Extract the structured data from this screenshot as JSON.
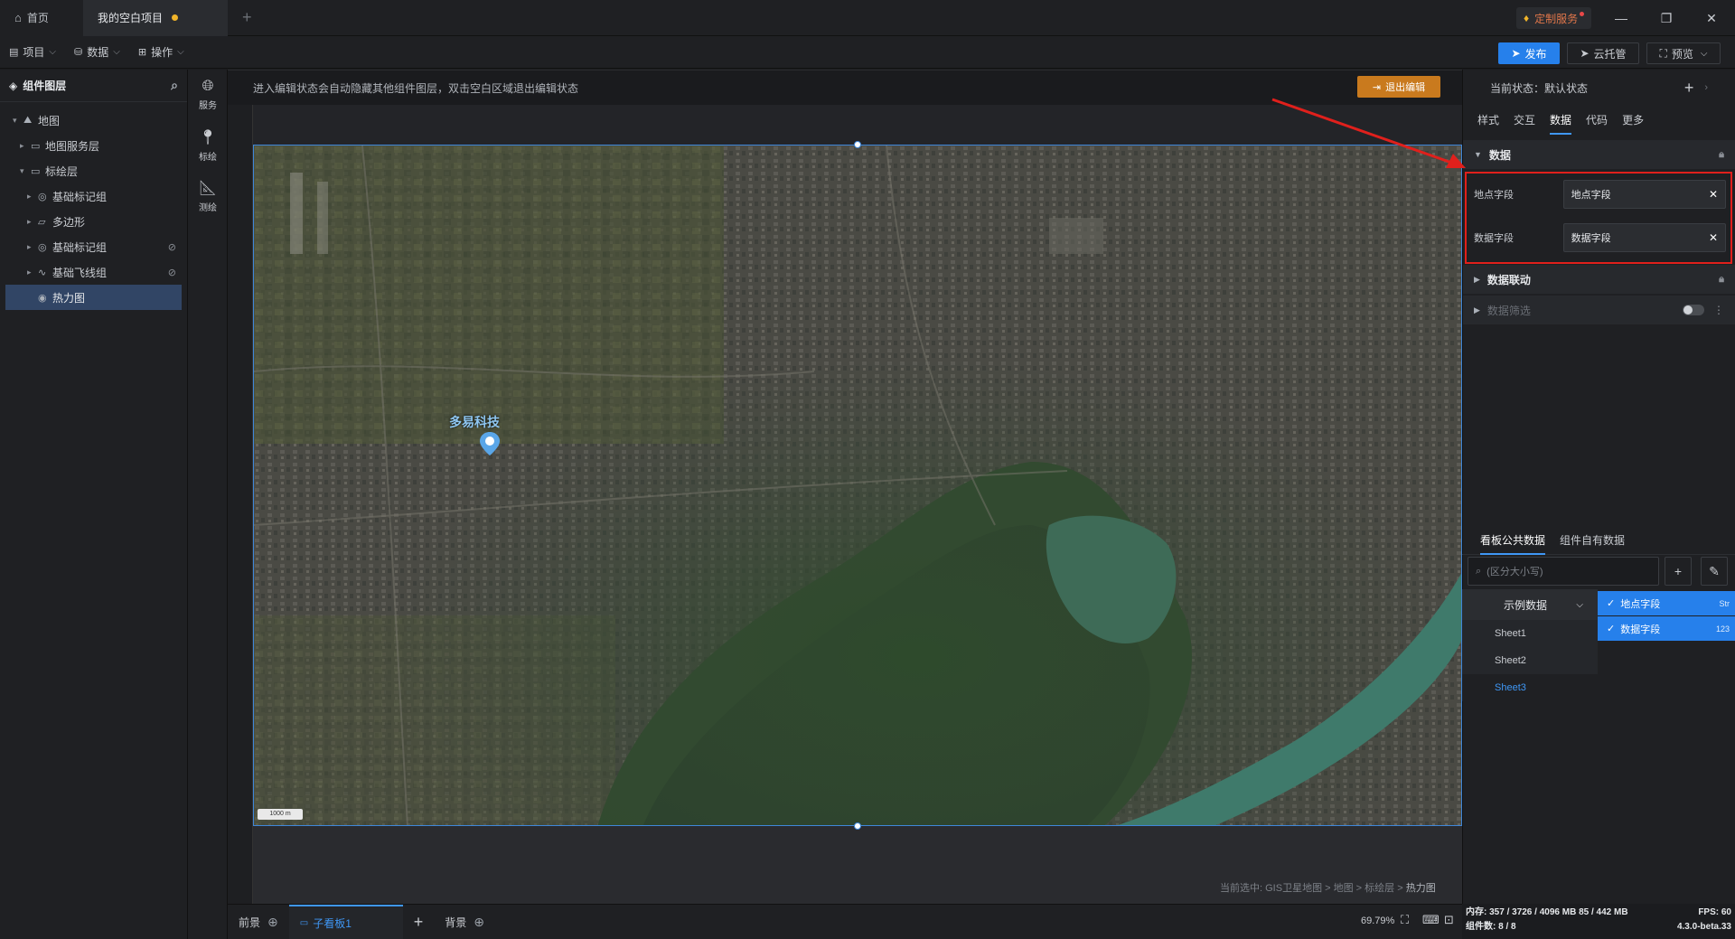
{
  "titlebar": {
    "home_tab": "首页",
    "project_tab": "我的空白项目",
    "add_tab": "+",
    "custom_service": "定制服务",
    "window_buttons": [
      "minimize-icon",
      "restore-icon",
      "close-icon"
    ]
  },
  "toolbar": {
    "menu_project": "项目",
    "menu_data": "数据",
    "menu_operate": "操作",
    "publish": "发布",
    "cloud_hosting": "云托管",
    "preview": "预览"
  },
  "layers": {
    "title": "组件图层",
    "tree": [
      {
        "label": "地图",
        "depth": 0,
        "expanded": true,
        "icon": "map-icon",
        "hidden": false
      },
      {
        "label": "地图服务层",
        "depth": 1,
        "expanded": false,
        "icon": "folder-icon",
        "hidden": false
      },
      {
        "label": "标绘层",
        "depth": 1,
        "expanded": true,
        "icon": "folder-icon",
        "hidden": false
      },
      {
        "label": "基础标记组",
        "depth": 2,
        "expanded": false,
        "icon": "marker-icon",
        "hidden": false
      },
      {
        "label": "多边形",
        "depth": 2,
        "expanded": false,
        "icon": "polygon-icon",
        "hidden": false
      },
      {
        "label": "基础标记组",
        "depth": 2,
        "expanded": false,
        "icon": "marker-icon",
        "hidden": true
      },
      {
        "label": "基础飞线组",
        "depth": 2,
        "expanded": false,
        "icon": "flyline-icon",
        "hidden": true
      },
      {
        "label": "热力图",
        "depth": 2,
        "expanded": false,
        "icon": "heatmap-icon",
        "hidden": false,
        "selected": true
      }
    ]
  },
  "tools": [
    {
      "label": "服务",
      "icon": "globe-icon"
    },
    {
      "label": "标绘",
      "icon": "pin-icon"
    },
    {
      "label": "测绘",
      "icon": "measure-icon"
    }
  ],
  "canvas": {
    "hint": "进入编辑状态会自动隐藏其他组件图层，双击空白区域退出编辑状态",
    "exit_edit": "退出编辑",
    "map_label": "多易科技",
    "scale_label": "1000 m",
    "breadcrumb_prefix": "当前选中:",
    "breadcrumb_path": "GIS卫星地图 > 地图 > 标绘层 >",
    "breadcrumb_current": "热力图"
  },
  "bottombar": {
    "foreground": "前景",
    "subboard": "子看板1",
    "add": "+",
    "background": "背景",
    "zoom": "69.79%"
  },
  "rpanel": {
    "state_label": "当前状态：默认状态",
    "tabs": [
      "样式",
      "交互",
      "数据",
      "代码",
      "更多"
    ],
    "active_tab": "数据",
    "data_section": "数据",
    "fields": [
      {
        "label": "地点字段",
        "value": "地点字段"
      },
      {
        "label": "数据字段",
        "value": "数据字段"
      }
    ],
    "data_linkage": "数据联动",
    "data_filter": "数据筛选"
  },
  "datasource": {
    "tabs": [
      "看板公共数据",
      "组件自有数据"
    ],
    "search_placeholder": "(区分大小写)",
    "group": "示例数据",
    "sheets": [
      "Sheet1",
      "Sheet2",
      "Sheet3"
    ],
    "active_sheet": "Sheet3",
    "fields": [
      {
        "label": "地点字段",
        "type": "Str"
      },
      {
        "label": "数据字段",
        "type": "123"
      }
    ]
  },
  "stats": {
    "memory": "内存: 357 / 3726 / 4096 MB  85 / 442 MB",
    "components": "组件数: 8 / 8",
    "fps": "FPS: 60",
    "version": "4.3.0-beta.33"
  },
  "colors": {
    "accent": "#2680eb",
    "exit_button": "#c97a1e",
    "annotation_red": "#e0201c"
  }
}
